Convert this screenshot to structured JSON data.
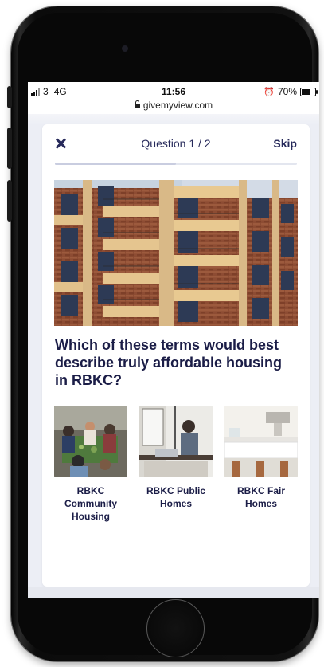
{
  "status_bar": {
    "carrier": "3",
    "network": "4G",
    "time": "11:56",
    "battery": "70%",
    "battery_level": 0.7
  },
  "browser": {
    "url": "givemyview.com"
  },
  "quiz": {
    "counter": "Question 1 / 2",
    "skip_label": "Skip",
    "progress": 0.5,
    "question": "Which of these terms would best describe truly affordable housing in RBKC?",
    "options": [
      {
        "label": "RBKC Community Housing",
        "image": "community-gathering-photo"
      },
      {
        "label": "RBKC Public Homes",
        "image": "person-at-laptop-photo"
      },
      {
        "label": "RBKC Fair Homes",
        "image": "kitchen-interior-photo"
      }
    ]
  },
  "colors": {
    "primary_text": "#1b1d47",
    "accent": "#26295a",
    "page_bg": "#eceef5"
  }
}
